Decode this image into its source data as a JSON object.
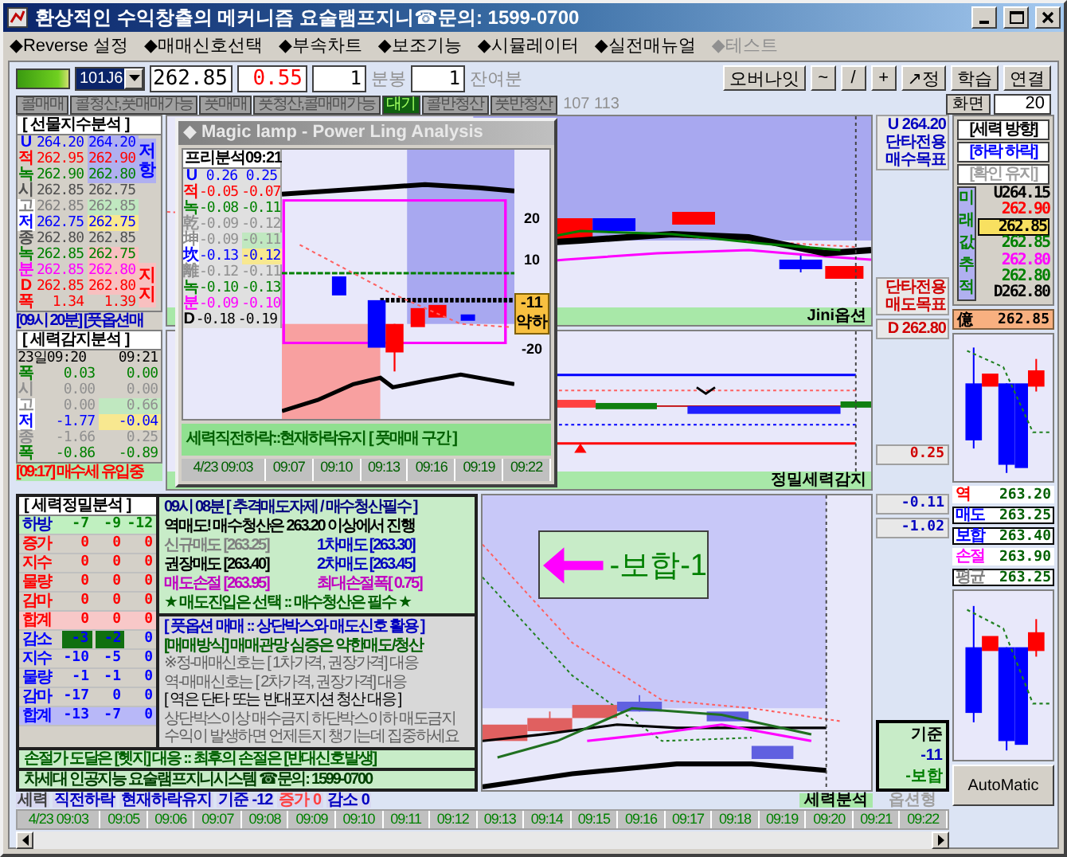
{
  "window": {
    "title": "환상적인 수익창출의 메커니즘 요술램프지니☎문의: 1599-0700"
  },
  "menu": [
    {
      "label": "◆Reverse 설정",
      "disabled": false
    },
    {
      "label": "◆매매신호선택",
      "disabled": false
    },
    {
      "label": "◆부속차트",
      "disabled": false
    },
    {
      "label": "◆보조기능",
      "disabled": false
    },
    {
      "label": "◆시뮬레이터",
      "disabled": false
    },
    {
      "label": "◆실전매뉴얼",
      "disabled": false
    },
    {
      "label": "◆테스트",
      "disabled": true
    }
  ],
  "toolbar": {
    "symbol": "101J6",
    "price": "262.85",
    "change": "0.55",
    "interval_value": "1",
    "interval_unit": "분봉",
    "remain_value": "1",
    "remain_unit": "잔여분",
    "buttons": [
      "오버나잇",
      "~",
      "/",
      "+",
      "↗정",
      "학습",
      "연결"
    ]
  },
  "signal_buttons": [
    {
      "label": "콜매매",
      "selected": false
    },
    {
      "label": "콜청산,풋매매가능",
      "selected": false
    },
    {
      "label": "풋매매",
      "selected": false
    },
    {
      "label": "풋청산,콜매매가능",
      "selected": false
    },
    {
      "label": "대기",
      "selected": true
    },
    {
      "label": "콜반청산",
      "selected": false
    },
    {
      "label": "풋반청산",
      "selected": false
    }
  ],
  "signal_counts": "107 113",
  "screen": {
    "label": "화면",
    "value": "20"
  },
  "index_analysis": {
    "title": "[ 선물지수분석 ]",
    "resistance": "저항",
    "support": "지지",
    "rows": [
      {
        "label": "U",
        "values": [
          "264.20",
          "264.20"
        ],
        "color": "#0000ff",
        "kind": "resistance"
      },
      {
        "label": "적",
        "values": [
          "262.95",
          "262.90"
        ],
        "color": "#ff0000",
        "kind": "resistance"
      },
      {
        "label": "녹",
        "values": [
          "262.90",
          "262.80"
        ],
        "color": "#008000",
        "kind": "resistance"
      },
      {
        "label": "시",
        "values": [
          "262.85",
          "262.75"
        ],
        "color": "#505050",
        "kind": "plain"
      },
      {
        "label": "고",
        "values": [
          "262.85",
          "262.85"
        ],
        "color": "#808080",
        "kind": "high"
      },
      {
        "label": "저",
        "values": [
          "262.75",
          "262.75"
        ],
        "color": "#0000ff",
        "kind": "low"
      },
      {
        "label": "종",
        "values": [
          "262.80",
          "262.85"
        ],
        "color": "#505050",
        "kind": "plain"
      },
      {
        "label": "녹",
        "values": [
          "262.85",
          "262.75"
        ],
        "color": "#008000",
        "kind": "support"
      },
      {
        "label": "분",
        "values": [
          "262.85",
          "262.80"
        ],
        "color": "#ff00ff",
        "kind": "support"
      },
      {
        "label": "D",
        "values": [
          "262.85",
          "262.80"
        ],
        "color": "#ff0000",
        "kind": "support"
      },
      {
        "label": "폭",
        "values": [
          "1.34",
          "1.39"
        ],
        "color": "#ff0000",
        "kind": "plain"
      }
    ]
  },
  "index_note": "[09시 20분] [풋옵션매",
  "power_detect": {
    "title": "[ 세력감지분석 ]",
    "header": [
      "23일09:20",
      "09:21"
    ],
    "rows": [
      {
        "label": "폭",
        "values": [
          "0.03",
          "0.00"
        ],
        "color": "#008000",
        "kind": "plain"
      },
      {
        "label": "시",
        "values": [
          "0.00",
          "0.00"
        ],
        "color": "#909090",
        "kind": "plain"
      },
      {
        "label": "고",
        "values": [
          "0.00",
          "0.66"
        ],
        "color": "#909090",
        "kind": "high"
      },
      {
        "label": "저",
        "values": [
          "-1.77",
          "-0.04"
        ],
        "color": "#0000ff",
        "kind": "low"
      },
      {
        "label": "종",
        "values": [
          "-1.66",
          "0.25"
        ],
        "color": "#909090",
        "kind": "plain"
      },
      {
        "label": "폭",
        "values": [
          "-0.86",
          "-0.89"
        ],
        "color": "#008000",
        "kind": "plain"
      }
    ]
  },
  "detect_note": "[09:17] 매수세 유입중",
  "magic_window": {
    "title": "◆ Magic lamp - Power Ling Analysis",
    "table_title": "프리분석09:21",
    "rows": [
      {
        "label": "U",
        "values": [
          "0.26",
          "0.25"
        ],
        "color": "#0000ff",
        "kind": "plain"
      },
      {
        "label": "적",
        "values": [
          "-0.05",
          "-0.07"
        ],
        "color": "#ff0000",
        "kind": "plain"
      },
      {
        "label": "녹",
        "values": [
          "-0.08",
          "-0.11"
        ],
        "color": "#008000",
        "kind": "plain"
      },
      {
        "label": "乾",
        "values": [
          "-0.09",
          "-0.12"
        ],
        "color": "#909090",
        "kind": "plain"
      },
      {
        "label": "坤",
        "values": [
          "-0.09",
          "-0.11"
        ],
        "color": "#909090",
        "kind": "high"
      },
      {
        "label": "坎",
        "values": [
          "-0.13",
          "-0.12"
        ],
        "color": "#0000ff",
        "kind": "low"
      },
      {
        "label": "離",
        "values": [
          "-0.12",
          "-0.11"
        ],
        "color": "#909090",
        "kind": "plain"
      },
      {
        "label": "녹",
        "values": [
          "-0.10",
          "-0.13"
        ],
        "color": "#008000",
        "kind": "plain"
      },
      {
        "label": "분",
        "values": [
          "-0.09",
          "-0.10"
        ],
        "color": "#ff00ff",
        "kind": "plain"
      },
      {
        "label": "D",
        "values": [
          "-0.18",
          "-0.19"
        ],
        "color": "#000000",
        "kind": "plain"
      }
    ],
    "axis_labels": [
      "20",
      "10",
      "-20"
    ],
    "signal_value": "-11",
    "signal_text": "약하",
    "status": "세력직전하락::현재하락유지 [ 풋매매 구간 ]",
    "times": [
      "4/23 09:03",
      "09:07",
      "09:10",
      "09:13",
      "09:16",
      "09:19",
      "09:22"
    ]
  },
  "chart_labels": {
    "buy_target": [
      "U 264.20",
      "단타전용",
      "매수목표"
    ],
    "sell_target": [
      "단타전용",
      "매도목표"
    ],
    "low_value": "D 262.80",
    "upper_caption": "Jini옵션",
    "middle_caption": "정밀세력감지",
    "middle_value": "0.25",
    "lower_values": [
      "-0.11",
      "-1.02"
    ],
    "basis": [
      "기준",
      "-11",
      "-보합"
    ],
    "lower_caption": "세력분석",
    "lower_caption_2": "옵션형",
    "signal_banner": "-보합-1"
  },
  "direction": {
    "title": "[세력 방향]",
    "lines": [
      {
        "text": "[하락 하락]",
        "kind": "active"
      },
      {
        "text": "[확인 유지]",
        "kind": "muted"
      }
    ],
    "side_label": "미래값추적",
    "values": [
      {
        "text": "U264.15",
        "color": "#000000",
        "selected": false
      },
      {
        "text": "262.90",
        "color": "#ff0000",
        "selected": false
      },
      {
        "text": "262.85",
        "color": "#000000",
        "selected": true
      },
      {
        "text": "262.85",
        "color": "#008000",
        "selected": false
      },
      {
        "text": "262.80",
        "color": "#ff00ff",
        "selected": false
      },
      {
        "text": "262.80",
        "color": "#008000",
        "selected": false
      },
      {
        "text": "D262.80",
        "color": "#000000",
        "selected": false
      }
    ],
    "current_label": "億",
    "current_value": "262.85"
  },
  "targets": [
    {
      "label": "역",
      "value": "263.20",
      "color": "#ff0000",
      "kind": "plain"
    },
    {
      "label": "매도",
      "value": "263.25",
      "color": "#0000ff",
      "kind": "boxed"
    },
    {
      "label": "보합",
      "value": "263.40",
      "color": "#0000ff",
      "kind": "boxed"
    },
    {
      "label": "손절",
      "value": "263.90",
      "color": "#ff00ff",
      "kind": "plain"
    },
    {
      "label": "평균",
      "value": "263.25",
      "color": "#808080",
      "kind": "boxed"
    }
  ],
  "precise": {
    "title": "[ 세력정밀분석 ]",
    "rows": [
      {
        "label": "하방",
        "values": [
          "-7",
          "-9",
          "-12"
        ],
        "color": "#0000c0",
        "kind": "head"
      },
      {
        "label": "증가",
        "values": [
          "0",
          "0",
          "0"
        ],
        "color": "#ff0000",
        "kind": "plain"
      },
      {
        "label": "지수",
        "values": [
          "0",
          "0",
          "0"
        ],
        "color": "#ff0000",
        "kind": "plain"
      },
      {
        "label": "물량",
        "values": [
          "0",
          "0",
          "0"
        ],
        "color": "#ff0000",
        "kind": "plain"
      },
      {
        "label": "감마",
        "values": [
          "0",
          "0",
          "0"
        ],
        "color": "#ff0000",
        "kind": "plain"
      },
      {
        "label": "합계",
        "values": [
          "0",
          "0",
          "0"
        ],
        "color": "#ff0000",
        "kind": "total_up"
      },
      {
        "label": "감소",
        "values": [
          "-3",
          "-2",
          "0"
        ],
        "color": "#0000ff",
        "kind": "boxed"
      },
      {
        "label": "지수",
        "values": [
          "-10",
          "-5",
          "0"
        ],
        "color": "#0000ff",
        "kind": "plain"
      },
      {
        "label": "물량",
        "values": [
          "-1",
          "-1",
          "0"
        ],
        "color": "#0000ff",
        "kind": "plain"
      },
      {
        "label": "감마",
        "values": [
          "-17",
          "0",
          "0"
        ],
        "color": "#0000ff",
        "kind": "plain"
      },
      {
        "label": "합계",
        "values": [
          "-13",
          "-7",
          "0"
        ],
        "color": "#0000ff",
        "kind": "total_down"
      }
    ]
  },
  "order_box": [
    {
      "kind": "wide",
      "text": "09시 08분 [ 추격매도자제 / 매수청산필수 ]",
      "color": "#000080"
    },
    {
      "kind": "wide",
      "text": "역매도! 매수청산은 263.20 이상에서 진행",
      "color": "#000000"
    },
    {
      "kind": "half",
      "text": "신규매도 [263.25]",
      "color": "#808080"
    },
    {
      "kind": "half",
      "text": "1차매도 [263.30]",
      "color": "#0000c0"
    },
    {
      "kind": "half",
      "text": "권장매도 [263.40]",
      "color": "#000000"
    },
    {
      "kind": "half",
      "text": "2차매도 [263.45]",
      "color": "#0000c0"
    },
    {
      "kind": "half",
      "text": "매도손절 [263.95]",
      "color": "#c000c0"
    },
    {
      "kind": "half",
      "text": "최대손절폭[ 0.75]",
      "color": "#c000c0"
    },
    {
      "kind": "wide",
      "text": "★ 매도진입은 선택 :: 매수청산은 필수 ★",
      "color": "#006000"
    }
  ],
  "guide_box": [
    {
      "text": "[ 풋옵션 매매 :: 상단박스와 매도신호 활용 ]",
      "color": "#0000c0"
    },
    {
      "text": "[매매방식] 매매관망 심증은 약한매도/청산",
      "color": "#006000"
    },
    {
      "text": "※정-매매신호는 [ 1차가격, 권장가격] 대응",
      "color": "#606060"
    },
    {
      "text": "역-매매신호는 [ 2차가격, 권장가격] 대응",
      "color": "#606060"
    },
    {
      "text": "[ 역은 단타 또는  반대포지션 청산 대응 ]",
      "color": "#000000"
    },
    {
      "text": "상단박스이상 매수금지  하단박스이하 매도금지",
      "color": "#606060"
    },
    {
      "text": "수익이 발생하면 언제든지 챙기는데 집중하세요",
      "color": "#606060"
    }
  ],
  "stop_note": "손절가 도달은 [헷지] 대응 :: 최후의 손절은 [반대신호발생]",
  "contact_note": "차세대 인공지능 요술램프지니시스템 ☎문의: 1599-0700",
  "status": [
    {
      "text": "세력",
      "color": "#404040"
    },
    {
      "text": "직전하락",
      "color": "#0000c0"
    },
    {
      "text": "현재하락유지",
      "color": "#0000c0"
    },
    {
      "text": "기준 -12",
      "color": "#0000c0"
    },
    {
      "text": "증가 0",
      "color": "#ff4040"
    },
    {
      "text": "감소 0",
      "color": "#0000c0"
    }
  ],
  "times": [
    "4/23 09:03",
    "09:05",
    "09:06",
    "09:07",
    "09:08",
    "09:09",
    "09:10",
    "09:11",
    "09:12",
    "09:13",
    "09:14",
    "09:15",
    "09:16",
    "09:17",
    "09:18",
    "09:19",
    "09:20",
    "09:21",
    "09:22"
  ],
  "auto_button": "AutoMatic"
}
